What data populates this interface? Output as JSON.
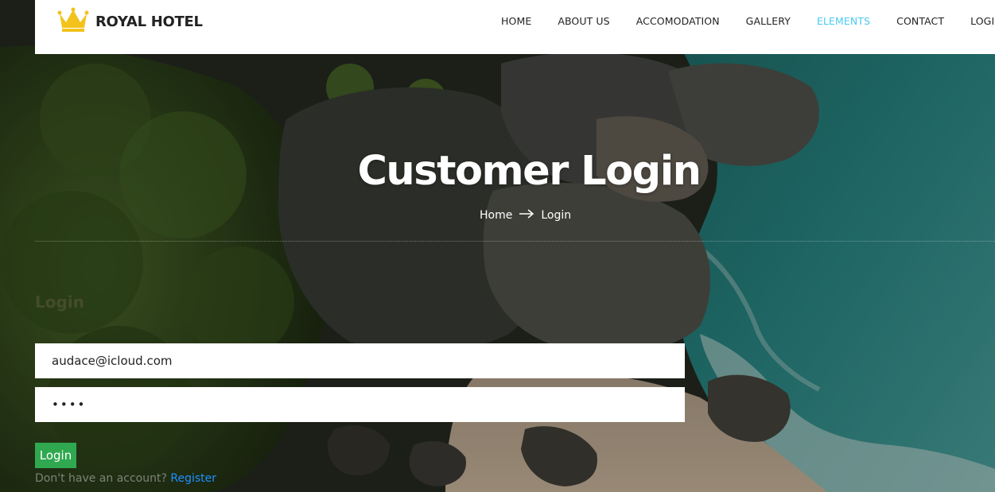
{
  "brand": {
    "name": "ROYAL HOTEL",
    "logo_icon": "crown-icon",
    "logo_color": "#f3c21c"
  },
  "nav": {
    "items": [
      {
        "label": "HOME"
      },
      {
        "label": "ABOUT US"
      },
      {
        "label": "ACCOMODATION"
      },
      {
        "label": "GALLERY"
      },
      {
        "label": "ELEMENTS",
        "active": true
      },
      {
        "label": "CONTACT"
      },
      {
        "label": "LOGI"
      }
    ],
    "active_color": "#4cc9f0"
  },
  "banner": {
    "title": "Customer Login",
    "breadcrumb": {
      "home": "Home",
      "arrow_icon": "arrow-right-icon",
      "current": "Login"
    }
  },
  "form": {
    "heading": "Login",
    "email_value": "audace@icloud.com",
    "password_value": "••••",
    "submit_label": "Login",
    "submit_color": "#2fa84f",
    "register_prompt": "Don't have an account?",
    "register_link": "Register",
    "register_color": "#1e90ff"
  }
}
